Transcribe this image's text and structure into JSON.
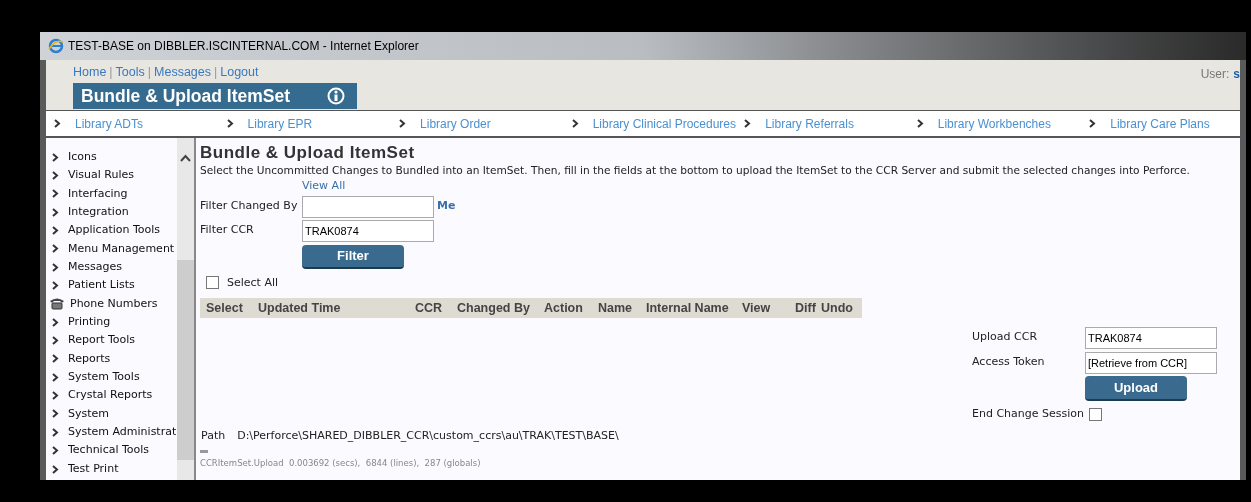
{
  "window": {
    "title": "TEST-BASE on DIBBLER.ISCINTERNAL.COM - Internet Explorer"
  },
  "header": {
    "links": [
      "Home",
      "Tools",
      "Messages",
      "Logout"
    ],
    "separator": "|",
    "user_label": "User:",
    "user_name": "s"
  },
  "page_tab": {
    "title": "Bundle & Upload ItemSet"
  },
  "library_links": [
    "Library ADTs",
    "Library EPR",
    "Library Order",
    "Library Clinical Procedures",
    "Library Referrals",
    "Library Workbenches",
    "Library Care Plans"
  ],
  "sidebar": {
    "items": [
      {
        "label": "Icons",
        "kind": "link"
      },
      {
        "label": "Visual Rules",
        "kind": "link"
      },
      {
        "label": "Interfacing",
        "kind": "link"
      },
      {
        "label": "Integration",
        "kind": "link"
      },
      {
        "label": "Application Tools",
        "kind": "link"
      },
      {
        "label": "Menu Management",
        "kind": "link"
      },
      {
        "label": "Messages",
        "kind": "link"
      },
      {
        "label": "Patient Lists",
        "kind": "link"
      },
      {
        "label": "Phone Numbers",
        "kind": "phone"
      },
      {
        "label": "Printing",
        "kind": "link"
      },
      {
        "label": "Report Tools",
        "kind": "link"
      },
      {
        "label": "Reports",
        "kind": "link"
      },
      {
        "label": "System Tools",
        "kind": "link"
      },
      {
        "label": "Crystal Reports",
        "kind": "link"
      },
      {
        "label": "System",
        "kind": "link"
      },
      {
        "label": "System Administrat",
        "kind": "link"
      },
      {
        "label": "Technical Tools",
        "kind": "link"
      },
      {
        "label": "Test Print",
        "kind": "link"
      }
    ]
  },
  "main": {
    "title": "Bundle & Upload ItemSet",
    "description": "Select the Uncommitted Changes to Bundled into an ItemSet. Then, fill in the fields at the bottom to upload the ItemSet to the CCR Server and submit the selected changes into Perforce.",
    "view_all": "View All",
    "filter_changed_by": {
      "label": "Filter Changed By",
      "me_link": "Me"
    },
    "filter_ccr": {
      "label": "Filter CCR",
      "value": "TRAK0874"
    },
    "filter_button": "Filter",
    "select_all": {
      "label": "Select All",
      "checked": false
    },
    "table": {
      "columns": [
        "Select",
        "Updated Time",
        "CCR",
        "Changed By",
        "Action",
        "Name",
        "Internal Name",
        "View",
        "Diff",
        "Undo"
      ]
    },
    "upload": {
      "upload_ccr": {
        "label": "Upload CCR",
        "value": "TRAK0874"
      },
      "access_token": {
        "label": "Access Token",
        "value": "[Retrieve from CCR]"
      },
      "button": "Upload",
      "end_change_session": {
        "label": "End Change Session",
        "checked": false
      }
    },
    "path": {
      "label": "Path",
      "value": "D:\\Perforce\\SHARED_DIBBLER_CCR\\custom_ccrs\\au\\TRAK\\TEST\\BASE\\"
    },
    "stats": "CCRItemSet.Upload  0.003692 (secs),  6844 (lines),  287 (globals)"
  }
}
